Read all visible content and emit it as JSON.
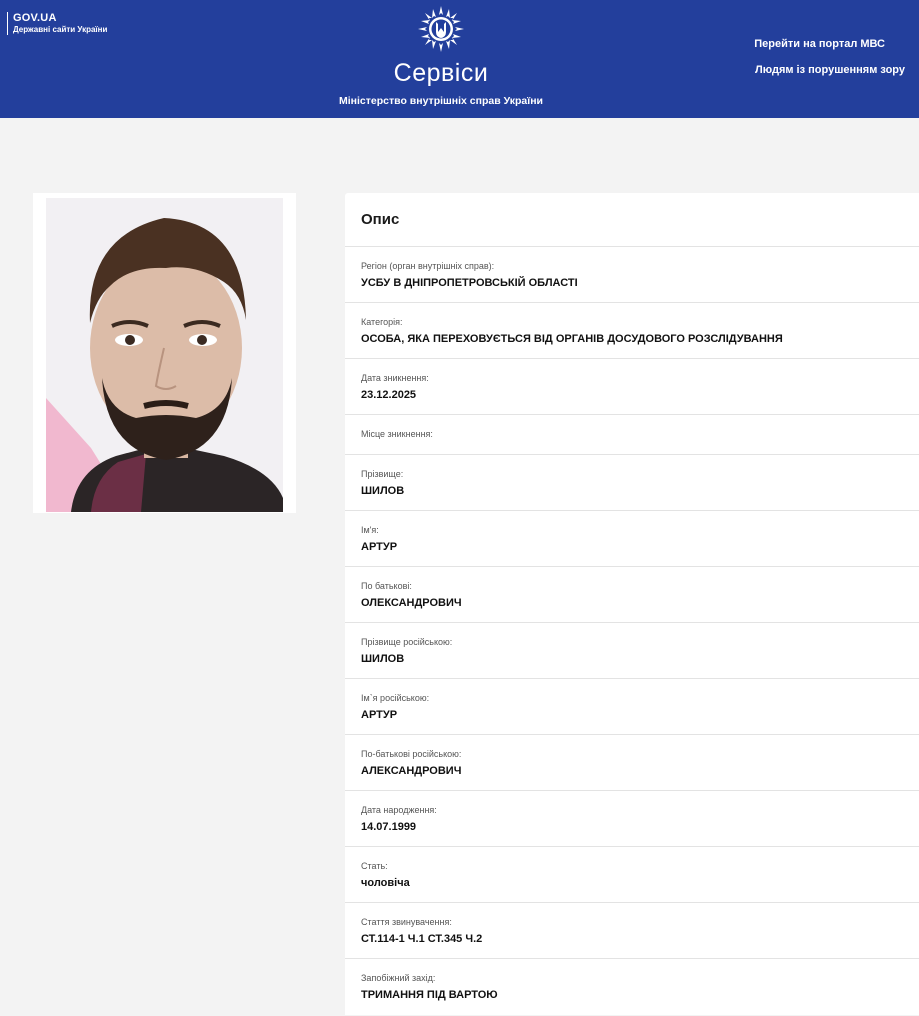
{
  "header": {
    "gov_title": "GOV.UA",
    "gov_subtitle": "Державні сайти України",
    "brand_title": "Сервіси",
    "brand_subtitle": "Міністерство внутрішніх справ України",
    "link_portal": "Перейти на портал МВС",
    "link_accessibility": "Людям із порушенням зору"
  },
  "colors": {
    "header_bg": "#233f9c",
    "page_bg": "#f3f3f3",
    "card_bg": "#ffffff"
  },
  "card": {
    "title": "Опис",
    "fields": [
      {
        "label": "Регіон (орган внутрішніх справ):",
        "value": "УСБУ В ДНІПРОПЕТРОВСЬКІЙ ОБЛАСТІ"
      },
      {
        "label": "Категорія:",
        "value": "ОСОБА, ЯКА ПЕРЕХОВУЄТЬСЯ ВІД ОРГАНІВ ДОСУДОВОГО РОЗСЛІДУВАННЯ"
      },
      {
        "label": "Дата зникнення:",
        "value": "23.12.2025"
      },
      {
        "label": "Місце зникнення:",
        "value": ""
      },
      {
        "label": "Прізвище:",
        "value": "ШИЛОВ"
      },
      {
        "label": "Ім'я:",
        "value": "АРТУР"
      },
      {
        "label": "По батькові:",
        "value": "ОЛЕКСАНДРОВИЧ"
      },
      {
        "label": "Прізвище російською:",
        "value": "ШИЛОВ"
      },
      {
        "label": "Ім`я російською:",
        "value": "АРТУР"
      },
      {
        "label": "По-батькові російською:",
        "value": "АЛЕКСАНДРОВИЧ"
      },
      {
        "label": "Дата народження:",
        "value": "14.07.1999"
      },
      {
        "label": "Стать:",
        "value": "чоловіча"
      },
      {
        "label": "Стаття звинувачення:",
        "value": "СТ.114-1 Ч.1 СТ.345 Ч.2"
      },
      {
        "label": "Запобіжний захід:",
        "value": "ТРИМАННЯ ПІД ВАРТОЮ"
      }
    ]
  }
}
